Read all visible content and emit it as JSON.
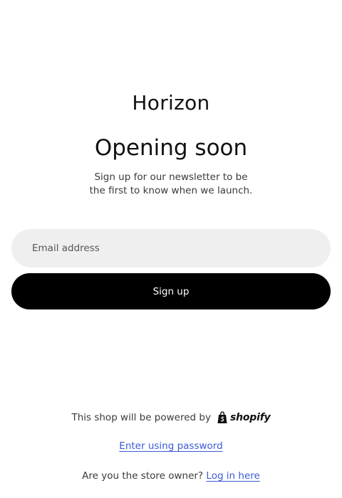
{
  "store": {
    "name": "Horizon"
  },
  "hero": {
    "headline": "Opening soon",
    "subtext_line1": "Sign up for our newsletter to be",
    "subtext_line2": "the first to know when we launch."
  },
  "newsletter": {
    "email_placeholder": "Email address",
    "email_value": "",
    "signup_label": "Sign up"
  },
  "footer": {
    "powered_by_text": "This shop will be powered by",
    "shopify_logo_text": "shopify",
    "shopify_logo_icon": "shopify-bag-icon",
    "password_link_label": "Enter using password",
    "owner_prompt": "Are you the store owner?",
    "login_link_label": "Log in here"
  },
  "colors": {
    "background": "#ffffff",
    "field_background": "#efefef",
    "button_background": "#000000",
    "button_text": "#ffffff",
    "link": "#3b5bd6"
  }
}
